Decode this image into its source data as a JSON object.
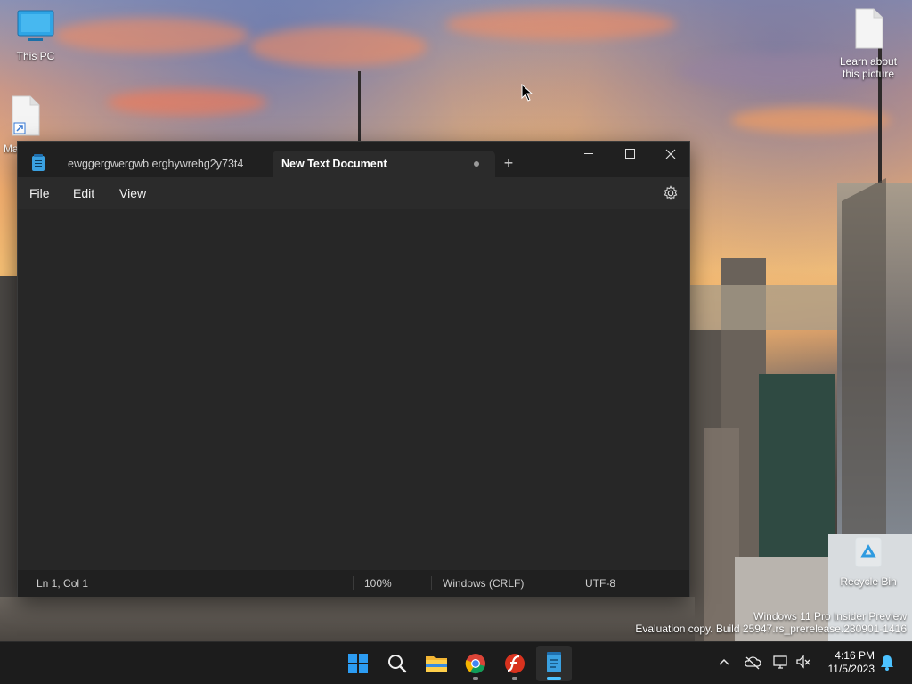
{
  "desktop": {
    "icons": [
      {
        "label": "This PC"
      },
      {
        "label": "Ma"
      },
      {
        "label": "Learn about this picture"
      },
      {
        "label": "Recycle Bin"
      }
    ],
    "watermark": {
      "line1": "Windows 11 Pro Insider Preview",
      "line2": "Evaluation copy. Build 25947.rs_prerelease.230901-1416"
    }
  },
  "notepad": {
    "tabs": [
      {
        "label": "ewggergwergwb erghywrehg2y73t4",
        "unsaved": true,
        "active": false
      },
      {
        "label": "New Text Document",
        "unsaved": true,
        "active": true
      }
    ],
    "new_tab_symbol": "+",
    "menu": {
      "file": "File",
      "edit": "Edit",
      "view": "View"
    },
    "editor_text": "",
    "status": {
      "position": "Ln 1, Col 1",
      "zoom": "100%",
      "line_ending": "Windows (CRLF)",
      "encoding": "UTF-8"
    }
  },
  "taskbar": {
    "apps": [
      {
        "name": "start",
        "icon": "windows-logo-icon"
      },
      {
        "name": "search",
        "icon": "search-icon"
      },
      {
        "name": "file-explorer",
        "icon": "folder-icon"
      },
      {
        "name": "chrome",
        "icon": "chrome-icon"
      },
      {
        "name": "flash",
        "icon": "flash-icon"
      },
      {
        "name": "notepad",
        "icon": "notepad-icon"
      }
    ],
    "clock": {
      "time": "4:16 PM",
      "date": "11/5/2023"
    }
  },
  "colors": {
    "accent": "#4cc2ff",
    "window_bg": "#202020",
    "editor_bg": "#272727"
  }
}
